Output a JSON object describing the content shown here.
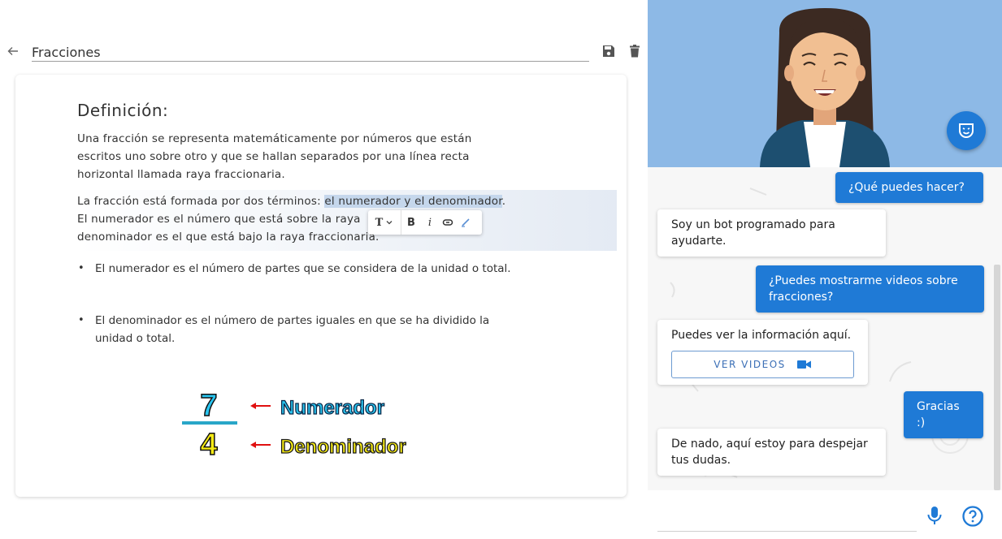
{
  "editor": {
    "title_value": "Fracciones",
    "heading": "Definición:",
    "paragraph1": "Una fracción se representa matemáticamente por números que están escritos uno sobre otro y que se hallan separados por una línea recta horizontal llamada raya fraccionaria.",
    "paragraph2_before": "La fracción está formada por dos términos: ",
    "paragraph2_selected": "el numerador y el denominador",
    "paragraph2_after": ".",
    "paragraph2_line2": "El numerador es el número que está sobre la raya",
    "paragraph2_line3": "denominador es el que está bajo la raya fraccionaria.",
    "bullets": [
      "El numerador es el número de partes que se considera de la unidad o total.",
      "El denominador es el número de partes iguales en que se ha dividido la unidad o total."
    ],
    "format_toolbar": {
      "text_label": "T",
      "bold_label": "B",
      "italic_label": "i"
    },
    "fraction_figure": {
      "numerator": "7",
      "denominator": "4",
      "numerator_label": "Numerador",
      "denominator_label": "Denominador"
    }
  },
  "chat": {
    "messages": [
      {
        "from": "user",
        "text": "¿Qué puedes hacer?"
      },
      {
        "from": "bot",
        "text": "Soy un bot programado para ayudarte."
      },
      {
        "from": "user",
        "text": "¿Puedes mostrarme videos sobre fracciones?"
      },
      {
        "from": "bot",
        "text": "Puedes ver la información aquí."
      },
      {
        "from": "user",
        "text": "Gracias :)"
      },
      {
        "from": "bot",
        "text": "De nado, aquí estoy para despejar tus dudas."
      }
    ],
    "ver_videos_label": "VER VIDEOS"
  },
  "colors": {
    "accent": "#1f7ad6",
    "avatar_bg": "#8db9e6",
    "selection": "#c5d7ec",
    "fraction_cyan": "#29c5f0",
    "fraction_yellow": "#f5ea14"
  },
  "icons": {
    "back": "arrow-left-icon",
    "save": "floppy-disk-icon",
    "delete": "trash-icon",
    "mask": "theater-mask-icon",
    "link": "link-icon",
    "highlight": "pen-icon",
    "video": "videocam-icon",
    "mic": "microphone-icon",
    "help": "help-circle-icon"
  }
}
